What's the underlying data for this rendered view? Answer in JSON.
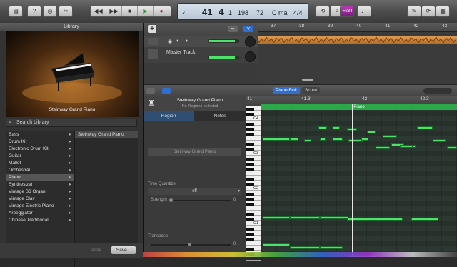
{
  "toolbar": {
    "library_icon": "library-icon",
    "help_icon": "help-icon",
    "smartcontrols_icon": "smart-controls-icon",
    "editors_icon": "scissors-icon",
    "transport": [
      "rewind-icon",
      "fast-forward-icon",
      "stop-icon",
      "play-icon",
      "record-icon"
    ],
    "lcd": {
      "bar": "41",
      "beat": "4",
      "division": "1",
      "tick": "198",
      "tempo": "72",
      "key": "C maj",
      "signature": "4/4"
    },
    "count_in": "⇥234",
    "right_icons": [
      "notepad-icon",
      "loop-browser-icon",
      "media-icon"
    ]
  },
  "library": {
    "title": "Library",
    "instrument_name": "Steinway Grand Piano",
    "search_placeholder": "Search Library",
    "categories": [
      {
        "label": "Bass",
        "selected": false
      },
      {
        "label": "Drum Kit",
        "selected": false
      },
      {
        "label": "Electronic Drum Kit",
        "selected": false
      },
      {
        "label": "Guitar",
        "selected": false
      },
      {
        "label": "Mallet",
        "selected": false
      },
      {
        "label": "Orchestral",
        "selected": false
      },
      {
        "label": "Piano",
        "selected": true
      },
      {
        "label": "Synthesizer",
        "selected": false
      },
      {
        "label": "Vintage B3 Organ",
        "selected": false
      },
      {
        "label": "Vintage Clav",
        "selected": false
      },
      {
        "label": "Vintage Electric Piano",
        "selected": false
      },
      {
        "label": "Arpeggiator",
        "selected": false
      },
      {
        "label": "Chinese Traditional",
        "selected": false
      }
    ],
    "patches": [
      "Steinway Grand Piano"
    ],
    "delete_label": "Delete",
    "save_label": "Save..."
  },
  "tracks": {
    "add_label": "+",
    "ruler": [
      "37",
      "38",
      "39",
      "40",
      "41",
      "42",
      "43"
    ],
    "master_label": "Master Track"
  },
  "editor": {
    "piano_roll_label": "Piano Roll",
    "score_label": "Score",
    "title": "Steinway Grand Piano",
    "subtitle": "No Regions selected",
    "region_tab": "Region",
    "notes_tab": "Notes",
    "region_name": "Steinway Grand Piano",
    "time_quantize_label": "Time Quantize",
    "quantize_value": "off",
    "strength_label": "Strength",
    "strength_value": "0",
    "transpose_label": "Transpose",
    "transpose_value": "0",
    "ruler": [
      "41",
      "41.3",
      "42",
      "42.3"
    ],
    "region_label": "Piano",
    "octave_labels": [
      "C4",
      "C3",
      "C2",
      "C1"
    ]
  },
  "colors": {
    "region_audio": "#d88a3c",
    "region_midi": "#2ca84a",
    "note": "#4fe26a",
    "selection": "#2f6fd0"
  }
}
